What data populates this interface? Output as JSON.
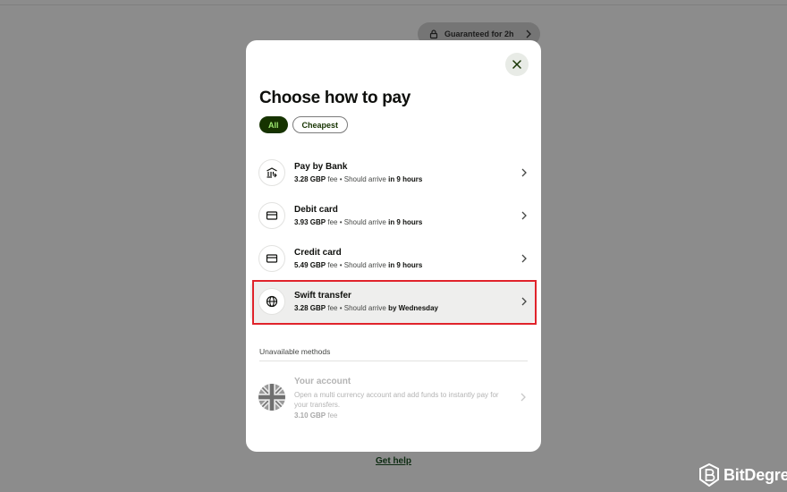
{
  "header": {
    "guarantee_label": "Guaranteed for 2h"
  },
  "modal": {
    "title": "Choose how to pay",
    "filters": [
      {
        "label": "All",
        "active": true
      },
      {
        "label": "Cheapest",
        "active": false
      }
    ],
    "methods": [
      {
        "name": "Pay by Bank",
        "fee": "3.28 GBP",
        "fee_suffix": " fee • Should arrive ",
        "eta": "in 9 hours",
        "icon": "bank-icon"
      },
      {
        "name": "Debit card",
        "fee": "3.93 GBP",
        "fee_suffix": " fee • Should arrive ",
        "eta": "in 9 hours",
        "icon": "card-icon"
      },
      {
        "name": "Credit card",
        "fee": "5.49 GBP",
        "fee_suffix": " fee • Should arrive ",
        "eta": "in 9 hours",
        "icon": "card-icon"
      },
      {
        "name": "Swift transfer",
        "fee": "3.28 GBP",
        "fee_suffix": " fee • Should arrive ",
        "eta": "by Wednesday",
        "icon": "globe-icon"
      }
    ],
    "unavailable_label": "Unavailable methods",
    "account": {
      "name": "Your account",
      "description": "Open a multi currency account and add funds to instantly pay for your transfers.",
      "fee": "3.10 GBP",
      "fee_suffix": " fee",
      "icon": "uk-flag-icon"
    }
  },
  "footer": {
    "help_link": "Get help"
  },
  "watermark": {
    "brand": "BitDegree"
  },
  "colors": {
    "accent_dark": "#163300",
    "accent_light": "#9fe870",
    "highlight_border": "#e0232b"
  }
}
